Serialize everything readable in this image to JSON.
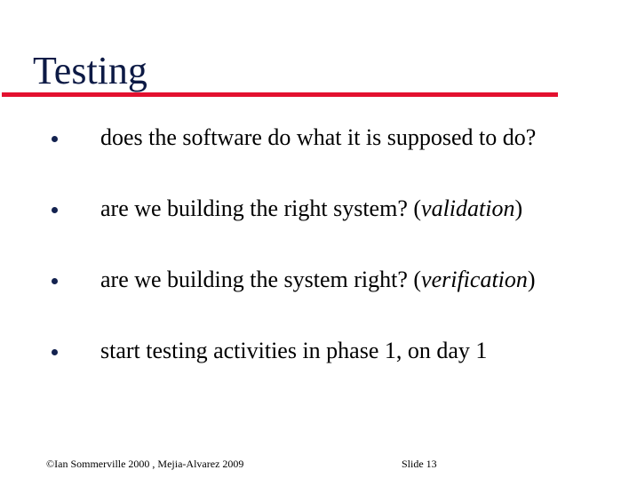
{
  "slide": {
    "title": "Testing",
    "accent_color": "#e3102f",
    "title_color": "#0d1a45",
    "bullets": [
      {
        "text": "does the software do what it is supposed to do?",
        "emphasis": "",
        "suffix": ""
      },
      {
        "text": "are we building the right system? (",
        "emphasis": "validation",
        "suffix": ")"
      },
      {
        "text": "are we building the system right? (",
        "emphasis": "verification",
        "suffix": ")"
      },
      {
        "text": "start testing activities in phase 1, on day 1",
        "emphasis": "",
        "suffix": ""
      }
    ],
    "footer": {
      "copyright": "©Ian Sommerville 2000 , Mejia-Alvarez 2009",
      "slide_number": "Slide  13"
    }
  }
}
